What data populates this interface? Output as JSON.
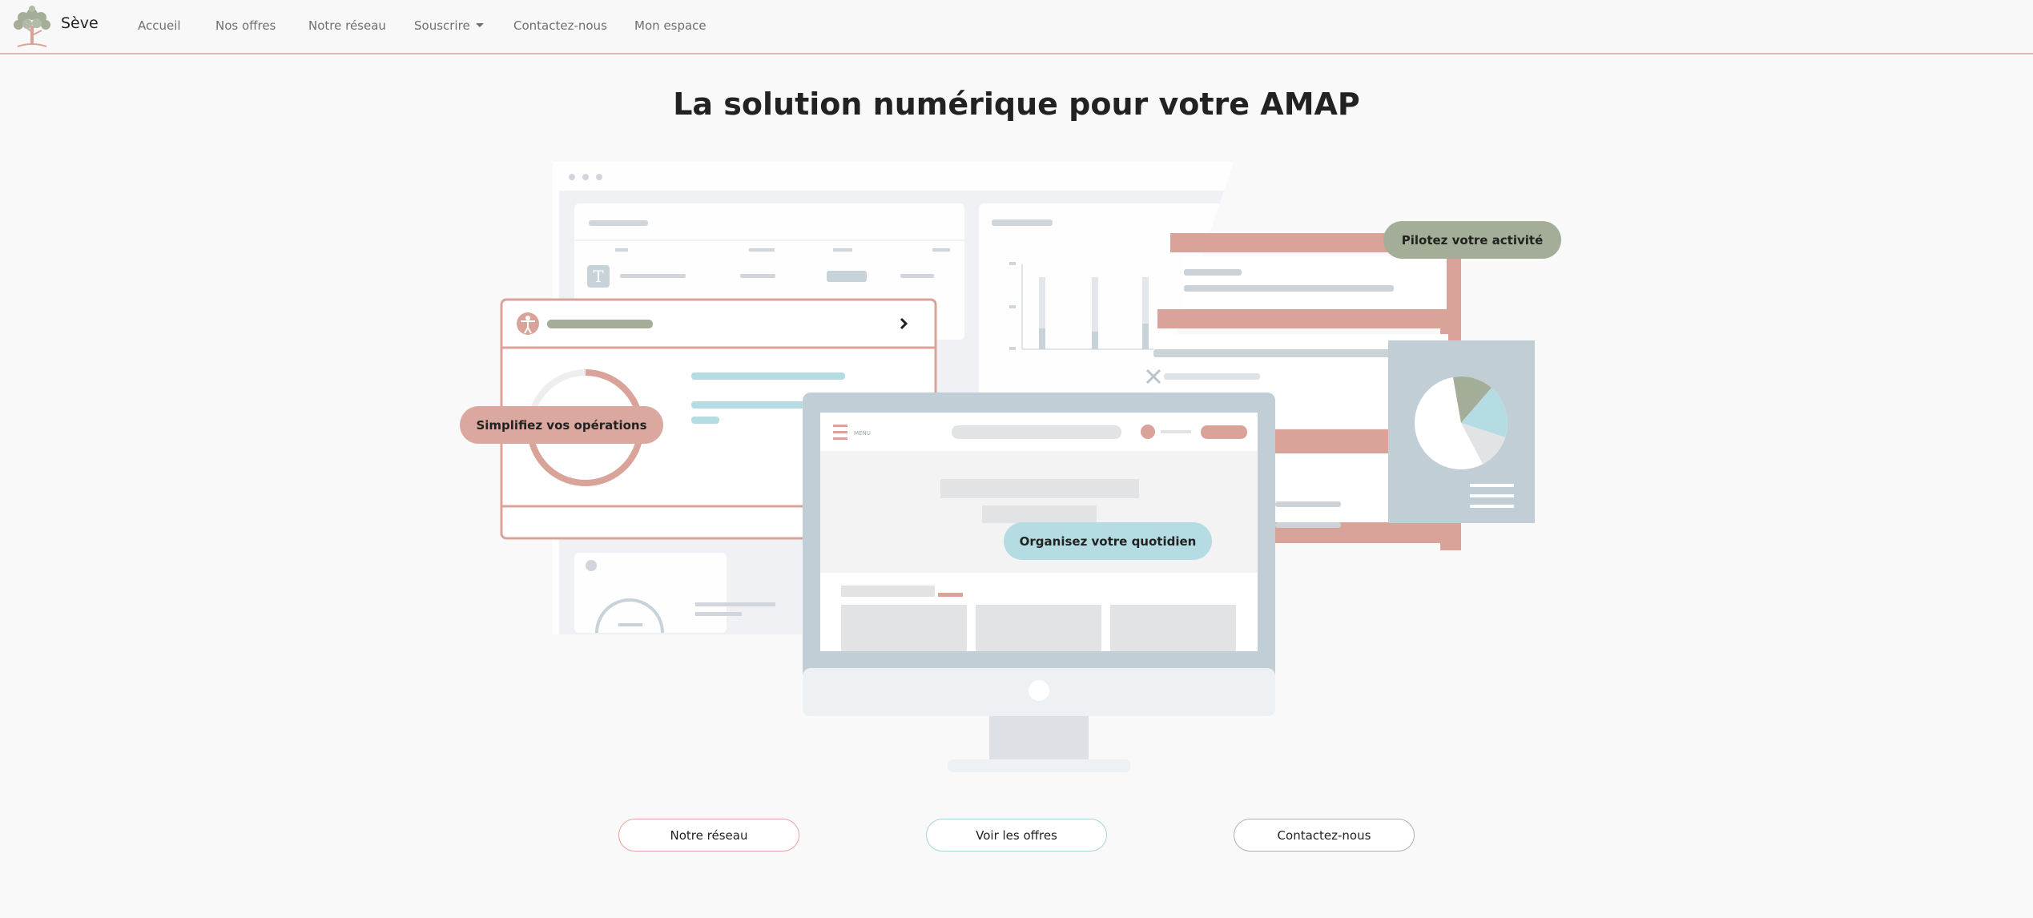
{
  "brand": {
    "name": "Sève",
    "logo_icon": "tree-icon"
  },
  "nav": {
    "items": [
      {
        "label": "Accueil"
      },
      {
        "label": "Nos offres"
      },
      {
        "label": "Notre réseau"
      },
      {
        "label": "Souscrire",
        "dropdown": true
      },
      {
        "label": "Contactez-nous"
      },
      {
        "label": "Mon espace"
      }
    ]
  },
  "hero": {
    "title": "La solution numérique pour votre AMAP",
    "badges": {
      "left": "Simplifiez vos opérations",
      "right": "Pilotez votre activité",
      "center": "Organisez votre quotidien"
    },
    "monitor_menu_label": "MENU"
  },
  "buttons": {
    "network": "Notre réseau",
    "offers": "Voir les offres",
    "contact": "Contactez-nous"
  },
  "colors": {
    "accent_pink": "#dba89f",
    "accent_green": "#a4ad98",
    "accent_blue": "#b5dce2",
    "nav_border": "#e8b7ae",
    "slate": "#c2ced6"
  }
}
